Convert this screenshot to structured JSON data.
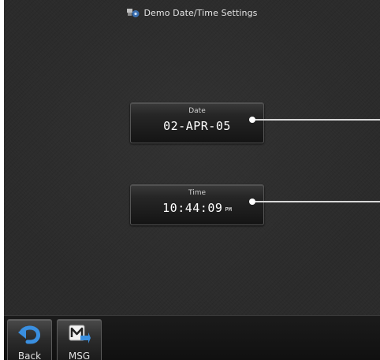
{
  "title": {
    "text": "Demo Date/Time Settings",
    "icon": "settings-icon"
  },
  "date_field": {
    "label": "Date",
    "value": "02-APR-05"
  },
  "time_field": {
    "label": "Time",
    "value": "10:44:09",
    "ampm": "PM"
  },
  "softkeys": [
    {
      "label": "Back",
      "icon": "back-arrow-icon"
    },
    {
      "label": "MSG",
      "icon": "message-icon"
    }
  ],
  "colors": {
    "background": "#2b2b2b",
    "accent": "#3a6fb0",
    "text": "#ffffff"
  }
}
